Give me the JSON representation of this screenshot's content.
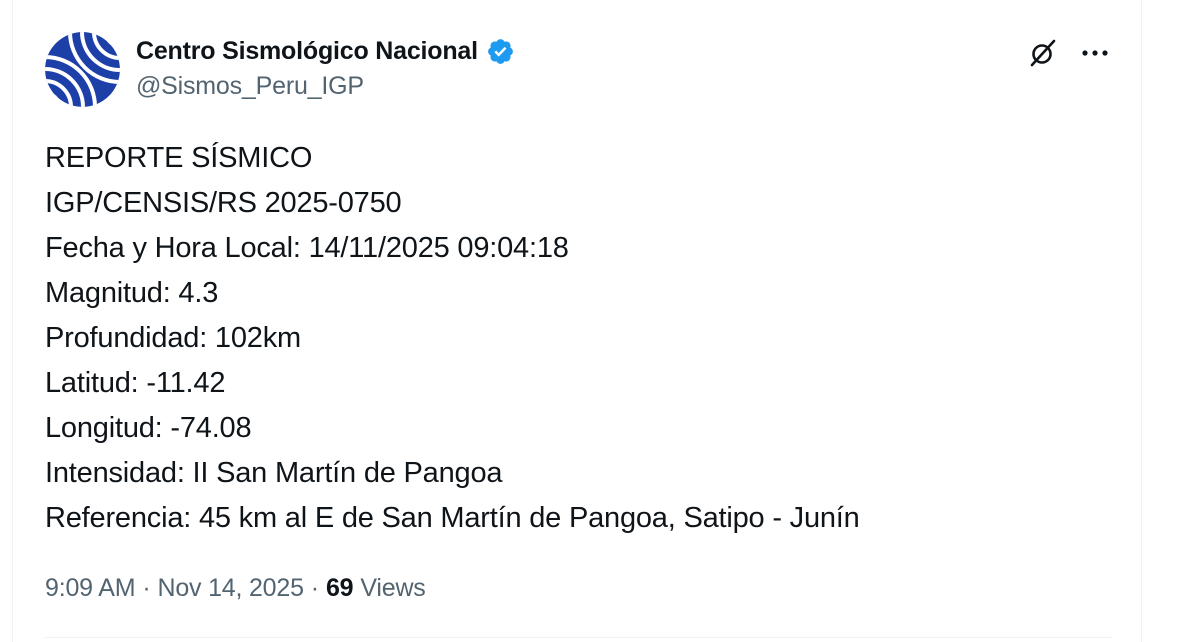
{
  "author": {
    "name": "Centro Sismológico Nacional",
    "handle": "@Sismos_Peru_IGP",
    "verified": true,
    "avatar_colors": [
      "#1d3fa8",
      "#ffffff"
    ]
  },
  "header_actions": {
    "grok_icon": "grok-icon",
    "more_icon": "more-horizontal-icon"
  },
  "tweet": {
    "lines": [
      "REPORTE SÍSMICO",
      "IGP/CENSIS/RS 2025-0750",
      "Fecha y Hora Local: 14/11/2025 09:04:18",
      "Magnitud: 4.3",
      "Profundidad: 102km",
      "Latitud: -11.42",
      "Longitud: -74.08",
      "Intensidad: II San Martín de Pangoa",
      "Referencia: 45 km al E de San Martín de Pangoa, Satipo - Junín"
    ]
  },
  "meta": {
    "time": "9:09 AM",
    "separator": "·",
    "date": "Nov 14, 2025",
    "views_count": "69",
    "views_label": "Views"
  },
  "colors": {
    "text_primary": "#0f1419",
    "text_secondary": "#536471",
    "verified_blue": "#1d9bf0",
    "border": "#eff3f4"
  }
}
